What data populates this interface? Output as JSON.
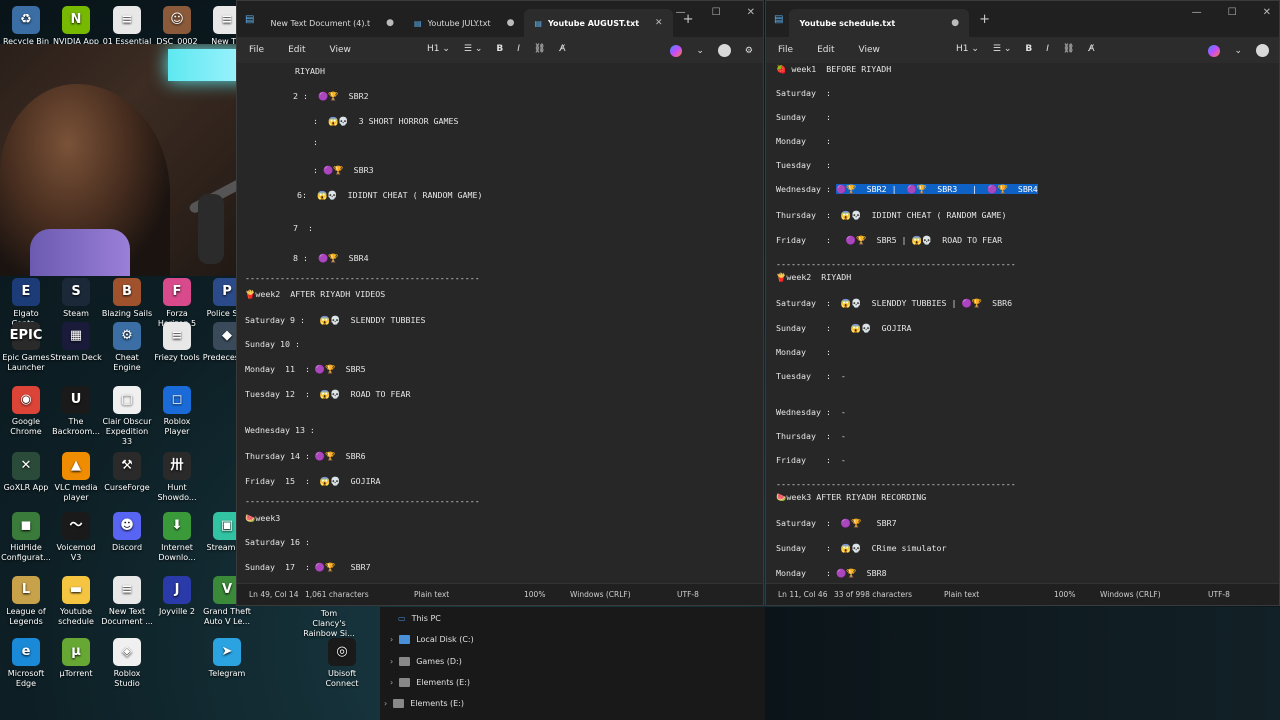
{
  "desktop_icons": [
    {
      "label": "Recycle Bin",
      "icon": "recycle-bin-icon",
      "color": "#3a6ea5",
      "glyph": "♻"
    },
    {
      "label": "NVIDIA App",
      "icon": "nvidia-icon",
      "color": "#76b900",
      "glyph": "N"
    },
    {
      "label": "01 Essential",
      "icon": "document-icon",
      "color": "#e8e8e8",
      "glyph": "≡"
    },
    {
      "label": "DSC_0002",
      "icon": "photo-icon",
      "color": "#8a5a3a",
      "glyph": "☺"
    },
    {
      "label": "New T...",
      "icon": "document-icon",
      "color": "#e8e8e8",
      "glyph": "≡"
    },
    {
      "label": "Elgato Contr...",
      "icon": "elgato-icon",
      "color": "#1c3c78",
      "glyph": "E"
    },
    {
      "label": "Steam",
      "icon": "steam-icon",
      "color": "#1b2838",
      "glyph": "S"
    },
    {
      "label": "Blazing Sails",
      "icon": "blazing-sails-icon",
      "color": "#a0522d",
      "glyph": "B"
    },
    {
      "label": "Forza Horizon 5",
      "icon": "forza-icon",
      "color": "#d84a8c",
      "glyph": "F"
    },
    {
      "label": "Police Sim",
      "icon": "police-sim-icon",
      "color": "#2a4a8a",
      "glyph": "P"
    },
    {
      "label": "Epic Games Launcher",
      "icon": "epic-games-icon",
      "color": "#2a2a2a",
      "glyph": "EPIC"
    },
    {
      "label": "Stream Deck",
      "icon": "stream-deck-icon",
      "color": "#1a1a3a",
      "glyph": "▦"
    },
    {
      "label": "Cheat Engine",
      "icon": "cheat-engine-icon",
      "color": "#3a6ea5",
      "glyph": "⚙"
    },
    {
      "label": "Friezy tools",
      "icon": "document-icon",
      "color": "#e8e8e8",
      "glyph": "≡"
    },
    {
      "label": "Predecessor",
      "icon": "predecessor-icon",
      "color": "#3a4a5a",
      "glyph": "◆"
    },
    {
      "label": "Google Chrome",
      "icon": "chrome-icon",
      "color": "#db4437",
      "glyph": "◉"
    },
    {
      "label": "The Backroom...",
      "icon": "unreal-icon",
      "color": "#1a1a1a",
      "glyph": "U"
    },
    {
      "label": "Clair Obscur Expedition 33",
      "icon": "document-icon",
      "color": "#f0f0f0",
      "glyph": "▢"
    },
    {
      "label": "Roblox Player",
      "icon": "roblox-icon",
      "color": "#1a6bd8",
      "glyph": "◻"
    },
    {
      "label": "GoXLR App",
      "icon": "goxlr-icon",
      "color": "#2a4a3a",
      "glyph": "✕"
    },
    {
      "label": "VLC media player",
      "icon": "vlc-icon",
      "color": "#f08c00",
      "glyph": "▲"
    },
    {
      "label": "CurseForge",
      "icon": "curseforge-icon",
      "color": "#2a2a2a",
      "glyph": "⚒"
    },
    {
      "label": "Hunt Showdo...",
      "icon": "hunt-icon",
      "color": "#2a2a2a",
      "glyph": "卅"
    },
    {
      "label": "HidHide Configurat...",
      "icon": "hidhide-icon",
      "color": "#3a7a3a",
      "glyph": "◼"
    },
    {
      "label": "Voicemod V3",
      "icon": "voicemod-icon",
      "color": "#1a1a1a",
      "glyph": "〜"
    },
    {
      "label": "Discord",
      "icon": "discord-icon",
      "color": "#5865f2",
      "glyph": "☻"
    },
    {
      "label": "Internet Downlo...",
      "icon": "idm-icon",
      "color": "#3a9a3a",
      "glyph": "⬇"
    },
    {
      "label": "StreamL...",
      "icon": "streamlabs-icon",
      "color": "#31c3a2",
      "glyph": "▣"
    },
    {
      "label": "League of Legends",
      "icon": "league-icon",
      "color": "#c8a24a",
      "glyph": "L"
    },
    {
      "label": "Youtube schedule",
      "icon": "folder-icon",
      "color": "#f5c542",
      "glyph": "▬"
    },
    {
      "label": "New Text Document ...",
      "icon": "document-icon",
      "color": "#e8e8e8",
      "glyph": "≡"
    },
    {
      "label": "Joyville 2",
      "icon": "joyville-icon",
      "color": "#2a3aa8",
      "glyph": "J"
    },
    {
      "label": "Grand Theft Auto V Le...",
      "icon": "gta-icon",
      "color": "#3a8a3a",
      "glyph": "V"
    },
    {
      "label": "Microsoft Edge",
      "icon": "edge-icon",
      "color": "#1a8ad8",
      "glyph": "e"
    },
    {
      "label": "µTorrent",
      "icon": "utorrent-icon",
      "color": "#66a833",
      "glyph": "µ"
    },
    {
      "label": "Roblox Studio",
      "icon": "roblox-studio-icon",
      "color": "#f0f0f0",
      "glyph": "◈"
    },
    {
      "label": "Telegram",
      "icon": "telegram-icon",
      "color": "#2aa3e0",
      "glyph": "➤"
    },
    {
      "label": "Ubisoft Connect",
      "icon": "ubisoft-icon",
      "color": "#1a1a1a",
      "glyph": "◎"
    },
    {
      "label": "Tom Clancy's Rainbow Si...",
      "icon": "rainbow-six-icon",
      "color": "#2a2a2a",
      "glyph": "R"
    }
  ],
  "left_window": {
    "tabs": [
      {
        "label": "New Text Document (4).t",
        "modified": true
      },
      {
        "label": "Youtube JULY.txt",
        "modified": true
      },
      {
        "label": "Youtube AUGUST.txt",
        "active": true
      }
    ],
    "menu": [
      "File",
      "Edit",
      "View"
    ],
    "heading_label": "H1",
    "lines": [
      {
        "text": "RIYADH"
      },
      {
        "text": "2 :  🟣🏆  SBR2"
      },
      {
        "text": "  :  😱💀  3 SHORT HORROR GAMES"
      },
      {
        "text": "  :"
      },
      {
        "text": "  : 🟣🏆  SBR3"
      },
      {
        "text": "6:  😱💀  IDIDNT CHEAT ( RANDOM GAME)"
      },
      {
        "text": "7  :"
      },
      {
        "text": "8 :  🟣🏆  SBR4"
      },
      {
        "text": "-----------------------------------------------"
      },
      {
        "text": "🍟week2  AFTER RIYADH VIDEOS"
      },
      {
        "text": "Saturday 9 :   😱💀  SLENDDY TUBBIES"
      },
      {
        "text": "Sunday 10 :"
      },
      {
        "text": "Monday  11  : 🟣🏆  SBR5"
      },
      {
        "text": "Tuesday 12  :  😱💀  ROAD TO FEAR"
      },
      {
        "text": "Wednesday 13 :"
      },
      {
        "text": "Thursday 14 : 🟣🏆  SBR6"
      },
      {
        "text": "Friday  15  :  😱💀  GOJIRA"
      },
      {
        "text": "-----------------------------------------------"
      },
      {
        "text": "🍉week3"
      },
      {
        "text": "Saturday 16 :"
      },
      {
        "text": "Sunday  17  : 🟣🏆   SBR7"
      }
    ],
    "status": {
      "position": "Ln 49, Col 14",
      "chars": "1,061 characters",
      "format": "Plain text",
      "zoom": "100%",
      "eol": "Windows (CRLF)",
      "encoding": "UTF-8"
    }
  },
  "right_window": {
    "tabs": [
      {
        "label": "Youtube schedule.txt",
        "modified": true
      }
    ],
    "menu": [
      "File",
      "Edit",
      "View"
    ],
    "heading_label": "H1",
    "lines": [
      {
        "text": "🍓 week1  BEFORE RIYADH"
      },
      {
        "text": "Saturday  :"
      },
      {
        "text": "Sunday    :"
      },
      {
        "text": "Monday    :"
      },
      {
        "text": "Tuesday   :"
      },
      {
        "text_before": "Wednesday : ",
        "highlight": "🟣🏆  SBR2 |  🟣🏆  SBR3   |  🟣🏆  SBR4"
      },
      {
        "text": "Thursday  :  😱💀  IDIDNT CHEAT ( RANDOM GAME)"
      },
      {
        "text": "Friday    :   🟣🏆  SBR5 | 😱💀  ROAD TO FEAR"
      },
      {
        "text": "------------------------------------------------"
      },
      {
        "text": "🍟week2  RIYADH"
      },
      {
        "text": "Saturday  :  😱💀  SLENDDY TUBBIES | 🟣🏆  SBR6"
      },
      {
        "text": "Sunday    :    😱💀  GOJIRA"
      },
      {
        "text": "Monday    :"
      },
      {
        "text": "Tuesday   :  -"
      },
      {
        "text": "Wednesday :  -"
      },
      {
        "text": "Thursday  :  -"
      },
      {
        "text": "Friday    :  -"
      },
      {
        "text": "------------------------------------------------"
      },
      {
        "text": "🍉week3 AFTER RIYADH RECORDING"
      },
      {
        "text": "Saturday  :  🟣🏆   SBR7"
      },
      {
        "text": "Sunday    :  😱💀  CRime simulator"
      },
      {
        "text": "Monday    : 🟣🏆  SBR8"
      }
    ],
    "status": {
      "position": "Ln 11, Col 46",
      "chars": "33 of 998 characters",
      "format": "Plain text",
      "zoom": "100%",
      "eol": "Windows (CRLF)",
      "encoding": "UTF-8"
    }
  },
  "explorer": {
    "items": [
      "This PC",
      "Local Disk (C:)",
      "Games (D:)",
      "Elements (E:)",
      "Elements (E:)"
    ]
  },
  "colors": {
    "selection": "#0f62c5",
    "editor_bg": "#272727",
    "chrome_bg": "#202020"
  }
}
